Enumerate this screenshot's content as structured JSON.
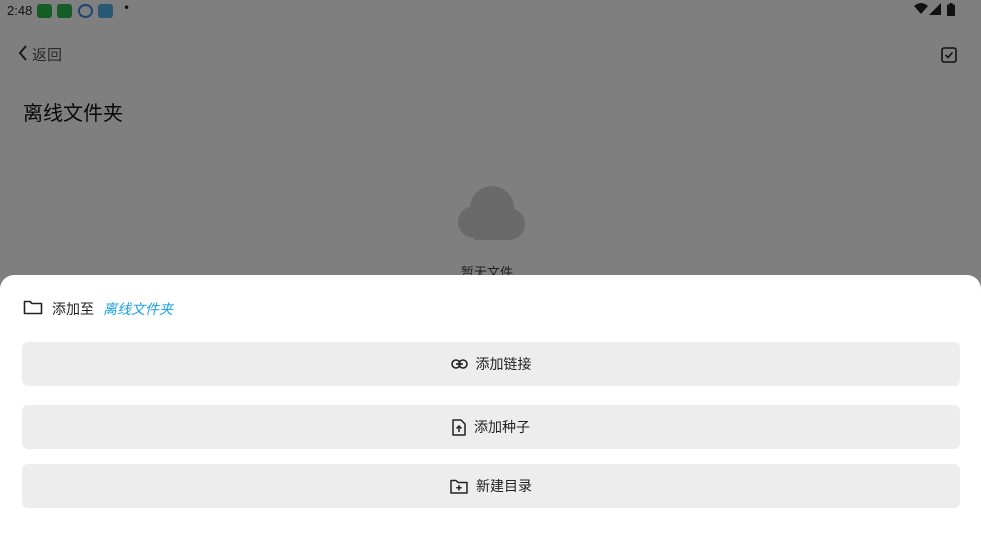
{
  "status_bar": {
    "time": "2:48",
    "dot": "•"
  },
  "header": {
    "back_label": "返回"
  },
  "page": {
    "title": "离线文件夹",
    "empty_text": "暂无文件"
  },
  "sheet": {
    "add_to_prefix": "添加至",
    "add_to_target": "离线文件夹",
    "actions": [
      {
        "label": "添加链接",
        "icon": "link-icon"
      },
      {
        "label": "添加种子",
        "icon": "file-upload-icon"
      },
      {
        "label": "新建目录",
        "icon": "folder-add-icon"
      }
    ]
  },
  "colors": {
    "accent": "#1aa3e8",
    "button_bg": "#ededed",
    "overlay": "rgba(0,0,0,0.5)"
  }
}
